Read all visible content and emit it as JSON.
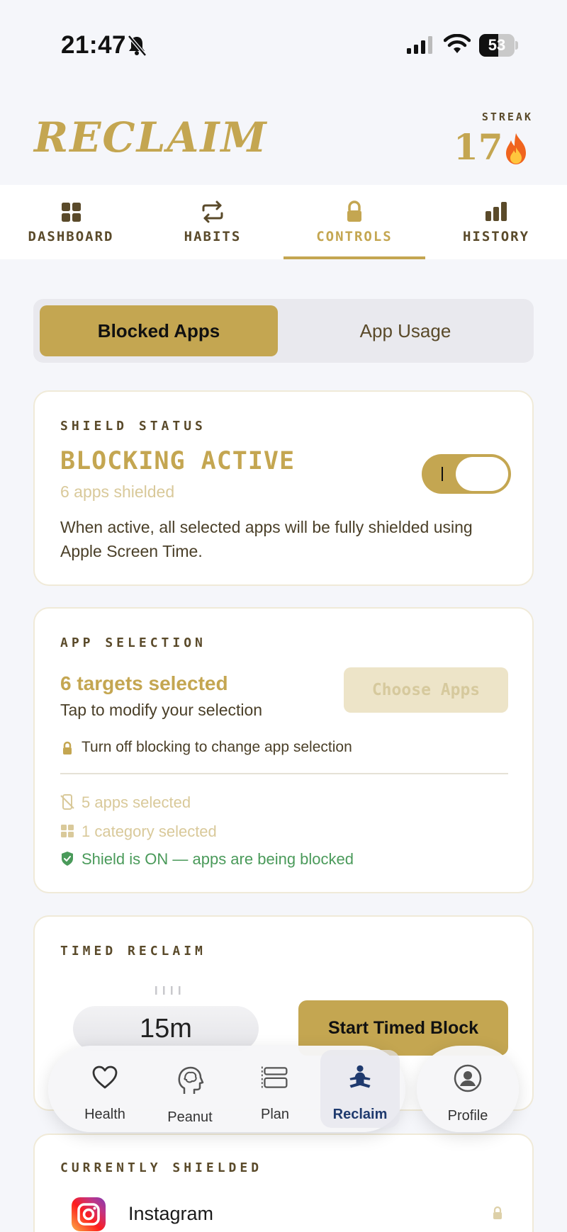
{
  "status_bar": {
    "time": "21:47",
    "battery": "53",
    "battery_level": 0.53
  },
  "header": {
    "brand": "RECLAIM",
    "streak_label": "STREAK",
    "streak_value": "17"
  },
  "tabs": [
    {
      "label": "DASHBOARD",
      "icon": "grid-icon"
    },
    {
      "label": "HABITS",
      "icon": "repeat-icon"
    },
    {
      "label": "CONTROLS",
      "icon": "lock-icon",
      "active": true
    },
    {
      "label": "HISTORY",
      "icon": "bar-chart-icon"
    }
  ],
  "segmented": {
    "active": "Blocked Apps",
    "inactive": "App Usage"
  },
  "shield_card": {
    "label": "SHIELD STATUS",
    "title": "BLOCKING ACTIVE",
    "subtitle": "6 apps shielded",
    "description": "When active, all selected apps will be fully shielded using Apple Screen Time.",
    "toggle_on": true
  },
  "selection_card": {
    "label": "APP SELECTION",
    "title": "6 targets selected",
    "subtitle": "Tap to modify your selection",
    "button": "Choose Apps",
    "lock_note": "Turn off blocking to change app selection",
    "apps_selected": "5 apps selected",
    "category_selected": "1 category selected",
    "shield_on": "Shield is ON — apps are being blocked"
  },
  "timed_card": {
    "label": "TIMED RECLAIM",
    "picker_value": "15m",
    "button": "Start Timed Block"
  },
  "shielded_card": {
    "label": "CURRENTLY SHIELDED",
    "apps": [
      "Instagram"
    ]
  },
  "bottom_nav": [
    {
      "label": "Health",
      "icon": "heart-icon"
    },
    {
      "label": "Peanut",
      "icon": "brain-head-icon"
    },
    {
      "label": "Plan",
      "icon": "plan-icon"
    },
    {
      "label": "Reclaim",
      "icon": "meditation-icon",
      "active": true
    }
  ],
  "profile_nav": {
    "label": "Profile",
    "icon": "person-circle-icon"
  },
  "colors": {
    "gold": "#c4a651",
    "brown": "#5a4a2a",
    "navy": "#1f3a6e",
    "green": "#4a9a5a",
    "light_gold": "#d9c99a"
  }
}
